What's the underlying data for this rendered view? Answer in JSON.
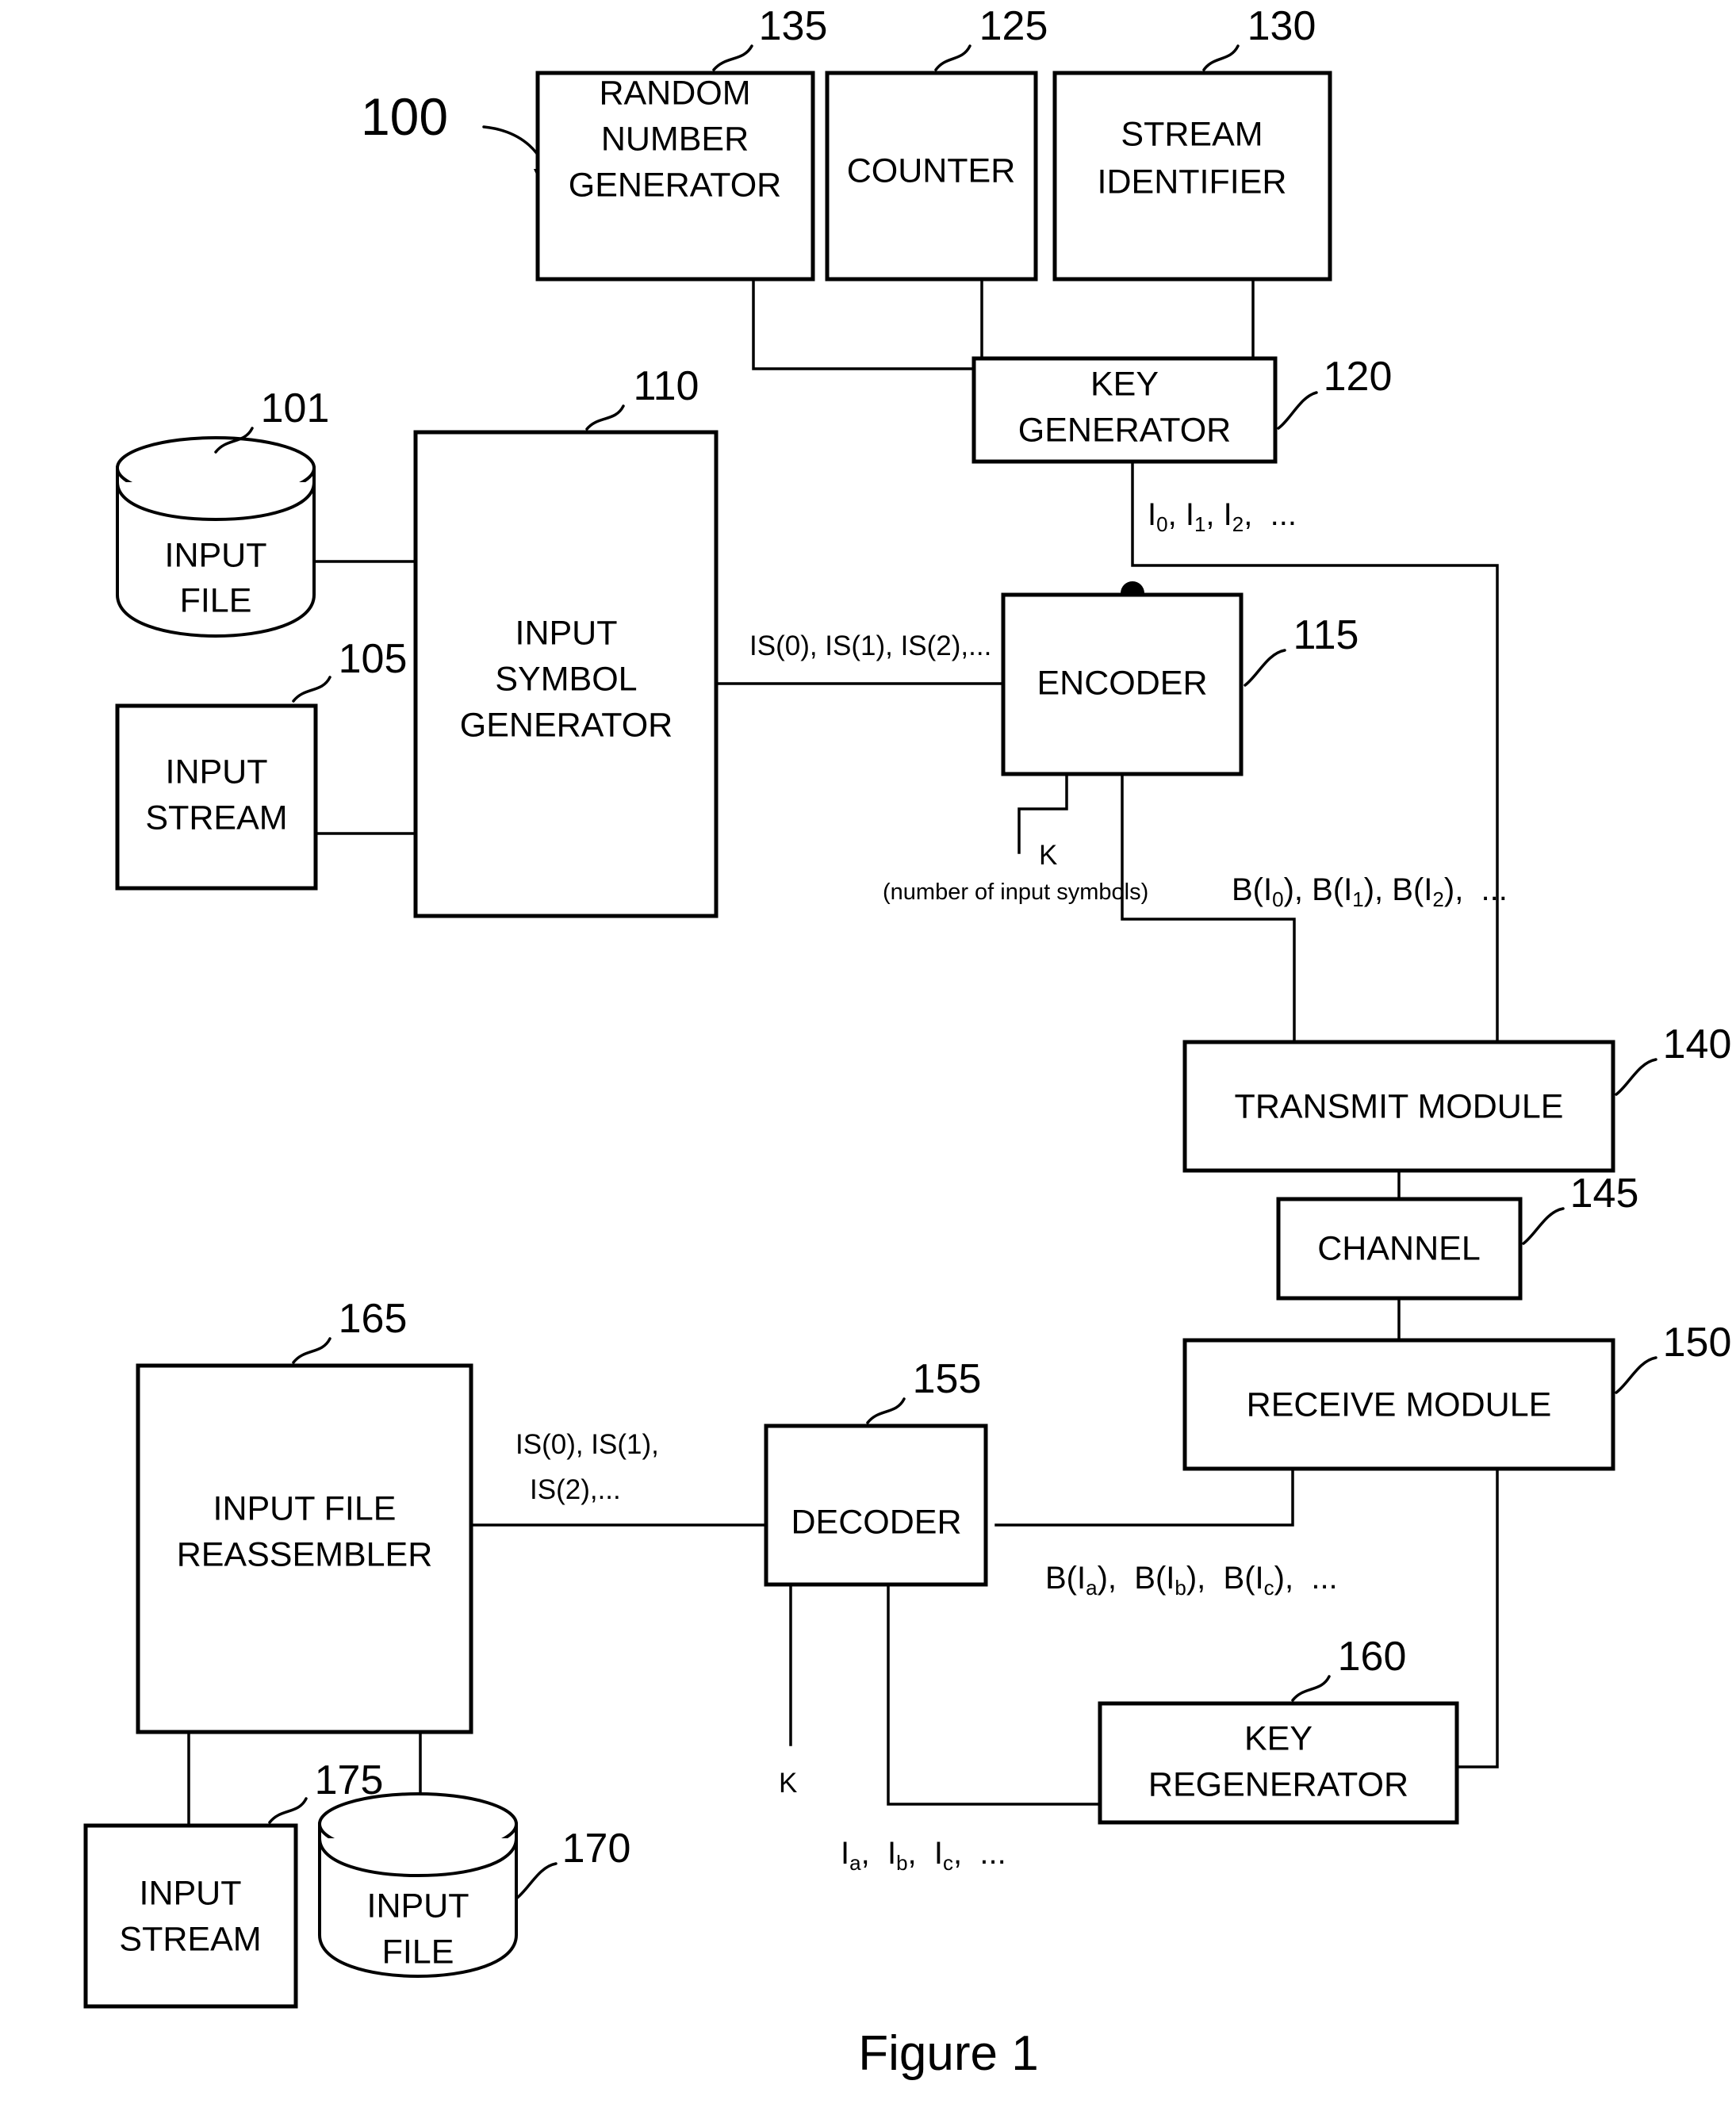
{
  "figure": {
    "caption": "Figure 1",
    "system_ref": "100"
  },
  "blocks": {
    "random_number_generator": {
      "label_lines": [
        "RANDOM",
        "NUMBER",
        "GENERATOR"
      ],
      "ref": "135"
    },
    "counter": {
      "label_lines": [
        "COUNTER"
      ],
      "ref": "125"
    },
    "stream_identifier": {
      "label_lines": [
        "STREAM",
        "IDENTIFIER"
      ],
      "ref": "130"
    },
    "key_generator": {
      "label_lines": [
        "KEY",
        "GENERATOR"
      ],
      "ref": "120"
    },
    "input_file_source": {
      "label_lines": [
        "INPUT",
        "FILE"
      ],
      "ref": "101"
    },
    "input_stream_source": {
      "label_lines": [
        "INPUT",
        "STREAM"
      ],
      "ref": "105"
    },
    "input_symbol_generator": {
      "label_lines": [
        "INPUT",
        "SYMBOL",
        "GENERATOR"
      ],
      "ref": "110"
    },
    "encoder": {
      "label_lines": [
        "ENCODER"
      ],
      "ref": "115"
    },
    "transmit_module": {
      "label_lines": [
        "TRANSMIT MODULE"
      ],
      "ref": "140"
    },
    "channel": {
      "label_lines": [
        "CHANNEL"
      ],
      "ref": "145"
    },
    "receive_module": {
      "label_lines": [
        "RECEIVE MODULE"
      ],
      "ref": "150"
    },
    "decoder": {
      "label_lines": [
        "DECODER"
      ],
      "ref": "155"
    },
    "key_regenerator": {
      "label_lines": [
        "KEY",
        "REGENERATOR"
      ],
      "ref": "160"
    },
    "input_file_reassembler": {
      "label_lines": [
        "INPUT FILE",
        "REASSEMBLER"
      ],
      "ref": "165"
    },
    "input_stream_output": {
      "label_lines": [
        "INPUT",
        "STREAM"
      ],
      "ref": "175"
    },
    "input_file_output": {
      "label_lines": [
        "INPUT",
        "FILE"
      ],
      "ref": "170"
    }
  },
  "signals": {
    "keys_out": {
      "base": "I",
      "items": [
        "0",
        "1",
        "2"
      ],
      "ellipsis": "..."
    },
    "input_symbols_to_encoder": "IS(0), IS(1), IS(2),...",
    "k_symbol": "K",
    "k_description": "(number of input symbols)",
    "encoded_out_prefix": "B(I",
    "encoded_out_items": [
      "0",
      "1",
      "2"
    ],
    "encoded_out_ellipsis": "...",
    "received_out_items": [
      "a",
      "b",
      "c"
    ],
    "received_out_ellipsis": "...",
    "regen_keys_items": [
      "a",
      "b",
      "c"
    ],
    "regen_keys_ellipsis": "...",
    "decoder_k_symbol": "K",
    "reassembler_symbols_line1": "IS(0), IS(1),",
    "reassembler_symbols_line2": "IS(2),..."
  },
  "colors": {
    "ink": "#000000",
    "paper": "#ffffff"
  }
}
